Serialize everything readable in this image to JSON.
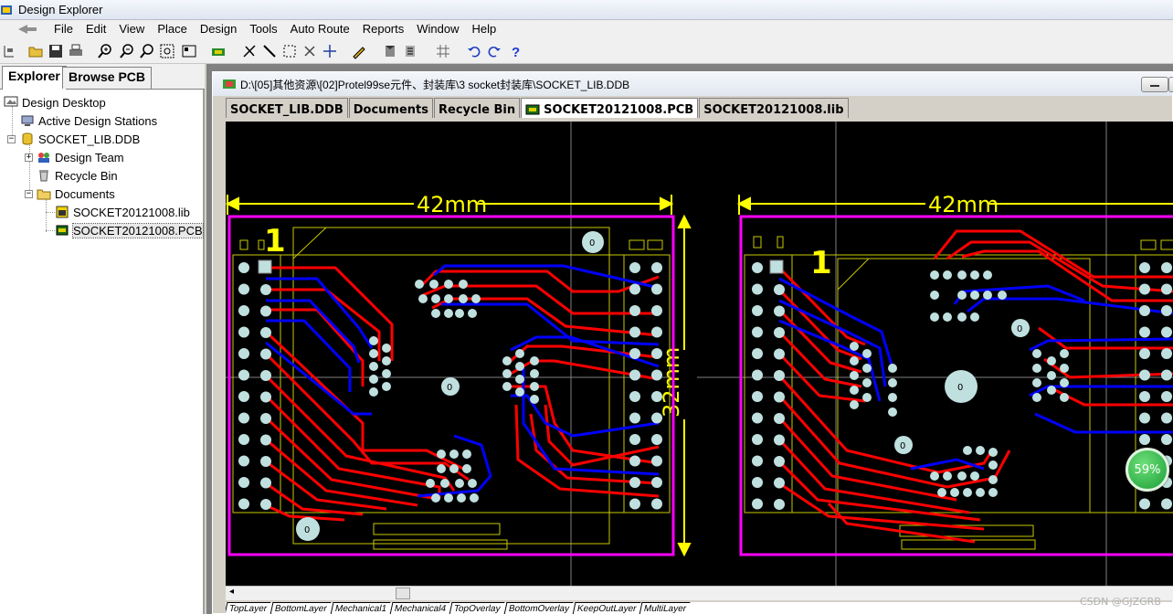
{
  "app": {
    "title": "Design Explorer"
  },
  "menu": [
    "File",
    "Edit",
    "View",
    "Place",
    "Design",
    "Tools",
    "Auto Route",
    "Reports",
    "Window",
    "Help"
  ],
  "toolbar_icons": [
    "project-icon",
    "open-icon",
    "save-icon",
    "print-icon",
    "zoom-in-icon",
    "zoom-out-icon",
    "zoom-area-icon",
    "zoom-fit-icon",
    "library-icon",
    "cut-icon",
    "line-icon",
    "select-rect-icon",
    "move-icon",
    "cross-icon",
    "pencil-icon",
    "component-icon",
    "component2-icon",
    "grid-icon",
    "undo-icon",
    "redo-icon",
    "help-icon"
  ],
  "left_tabs": [
    "Explorer",
    "Browse PCB"
  ],
  "tree": {
    "root": "Design Desktop",
    "stations": "Active Design Stations",
    "db": "SOCKET_LIB.DDB",
    "team": "Design Team",
    "recycle": "Recycle Bin",
    "documents": "Documents",
    "lib_file": "SOCKET20121008.lib",
    "pcb_file": "SOCKET20121008.PCB"
  },
  "document": {
    "path": "D:\\[05]其他资源\\[02]Protel99se元件、封装库\\3 socket封装库\\SOCKET_LIB.DDB",
    "tabs": [
      {
        "label": "SOCKET_LIB.DDB",
        "active": false
      },
      {
        "label": "Documents",
        "active": false
      },
      {
        "label": "Recycle Bin",
        "active": false
      },
      {
        "label": "SOCKET20121008.PCB",
        "active": true
      },
      {
        "label": "SOCKET20121008.lib",
        "active": false
      }
    ]
  },
  "pcb": {
    "dim_width_left": "42mm",
    "dim_width_right": "42mm",
    "dim_height": "32mm",
    "pin1_left": "1",
    "pin1_right": "1",
    "hole_label": "0"
  },
  "layer_tabs": [
    "TopLayer",
    "BottomLayer",
    "Mechanical1",
    "Mechanical4",
    "TopOverlay",
    "BottomOverlay",
    "KeepOutLayer",
    "MultiLayer"
  ],
  "badge": "59%",
  "watermark": "CSDN @GJZGRB",
  "colors": {
    "pcb_bg": "#000000",
    "dimension": "#ffff00",
    "keepout": "#ff00ff",
    "top_trace": "#ff0000",
    "bottom_trace": "#0000ff",
    "pad": "#c0e0e0",
    "overlay": "#c8c800"
  }
}
